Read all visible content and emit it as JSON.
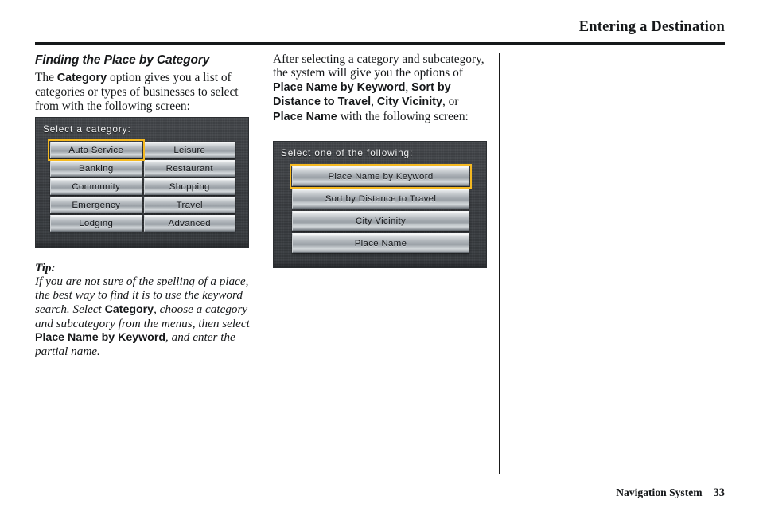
{
  "header": {
    "title": "Entering a Destination"
  },
  "footer": {
    "label": "Navigation System",
    "page_number": "33"
  },
  "left_column": {
    "section_title": "Finding the Place by Category",
    "intro_prefix": "The ",
    "intro_bold": "Category",
    "intro_suffix": " option gives you a list of categories or types of businesses to select from with the following screen:",
    "tip": {
      "label": "Tip:",
      "part1": "If you are not sure of the spelling of a place, the best way to find it is to use the keyword search. Select ",
      "bold1": "Category",
      "part2": ", choose a category and subcategory from the menus, then select ",
      "bold2": "Place Name by Keyword",
      "part3": ", and enter the partial name."
    }
  },
  "middle_column": {
    "intro_part1": "After selecting a category and subcategory, the system will give you the options of ",
    "bold1": "Place Name by Keyword",
    "intro_part2": ", ",
    "bold2": "Sort by Distance to Travel",
    "intro_part3": ", ",
    "bold3": "City Vicinity",
    "intro_part4": ", or ",
    "bold4": "Place Name",
    "intro_part5": " with the following screen:"
  },
  "screens": {
    "category": {
      "title": "Select a category:",
      "selected_color": "#f5b921",
      "rows": [
        [
          {
            "label": "Auto Service",
            "selected": true
          },
          {
            "label": "Leisure",
            "selected": false
          }
        ],
        [
          {
            "label": "Banking",
            "selected": false
          },
          {
            "label": "Restaurant",
            "selected": false
          }
        ],
        [
          {
            "label": "Community",
            "selected": false
          },
          {
            "label": "Shopping",
            "selected": false
          }
        ],
        [
          {
            "label": "Emergency",
            "selected": false
          },
          {
            "label": "Travel",
            "selected": false
          }
        ],
        [
          {
            "label": "Lodging",
            "selected": false
          },
          {
            "label": "Advanced",
            "selected": false
          }
        ]
      ]
    },
    "following": {
      "title": "Select one of the following:",
      "selected_color": "#f5b921",
      "buttons": [
        {
          "label": "Place Name by Keyword",
          "selected": true
        },
        {
          "label": "Sort by Distance to Travel",
          "selected": false
        },
        {
          "label": "City Vicinity",
          "selected": false
        },
        {
          "label": "Place Name",
          "selected": false
        }
      ]
    }
  }
}
